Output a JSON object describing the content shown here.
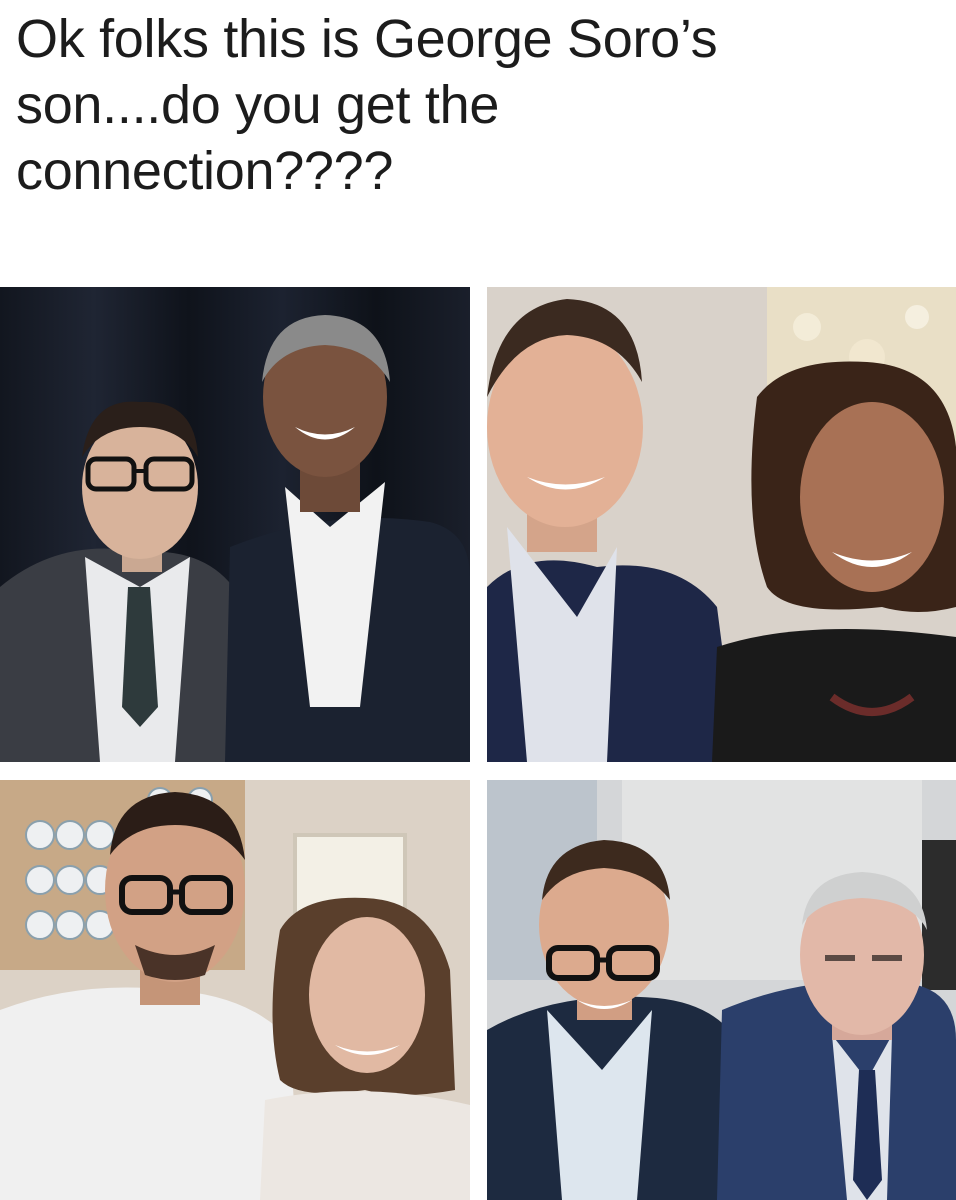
{
  "caption": {
    "lines": [
      "Ok folks this is George Soro’s",
      "son....do you get the",
      "connection????"
    ]
  },
  "photos": [
    {
      "scene": "two men in suits in front of a dark curtain"
    },
    {
      "scene": "selfie of a man with a smiling woman"
    },
    {
      "scene": "man in glasses with a woman in a kitchen"
    },
    {
      "scene": "man in glasses with an older man in a suit"
    }
  ]
}
